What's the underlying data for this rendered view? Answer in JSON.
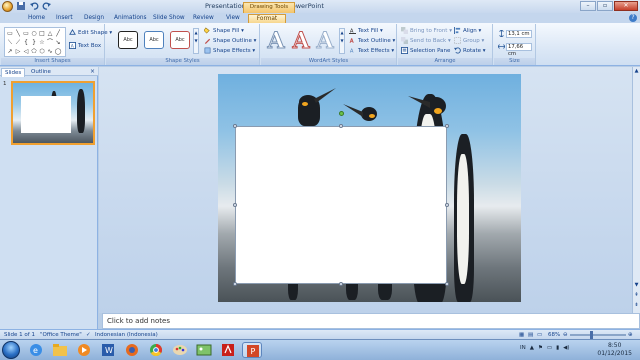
{
  "window": {
    "title": "Presentation1 - Microsoft PowerPoint",
    "contextual_tab": "Drawing Tools",
    "minimize": "–",
    "maximize": "▫",
    "close": "✕"
  },
  "tabs": {
    "home": "Home",
    "insert": "Insert",
    "design": "Design",
    "animations": "Animations",
    "slideshow": "Slide Show",
    "review": "Review",
    "view": "View",
    "format": "Format",
    "help": "?"
  },
  "ribbon": {
    "insert_shapes": {
      "label": "Insert Shapes",
      "edit_shape": "Edit Shape ▾",
      "text_box": "Text Box",
      "shape_glyphs": [
        "▭",
        "╲",
        "▭",
        "○",
        "□",
        "△",
        "╱",
        "⟍",
        "⟋",
        "{",
        "}",
        "☆",
        "⌒",
        "↘",
        "↗",
        "▷",
        "◁",
        "⬠",
        "⬡",
        "∿",
        "◯"
      ]
    },
    "shape_styles": {
      "label": "Shape Styles",
      "swatch_text": "Abc",
      "fill": "Shape Fill ▾",
      "outline": "Shape Outline ▾",
      "effects": "Shape Effects ▾"
    },
    "wordart": {
      "label": "WordArt Styles",
      "letter": "A",
      "text_fill": "Text Fill ▾",
      "text_outline": "Text Outline ▾",
      "text_effects": "Text Effects ▾"
    },
    "arrange": {
      "label": "Arrange",
      "bring_front": "Bring to Front ▾",
      "send_back": "Send to Back ▾",
      "selection_pane": "Selection Pane",
      "align": "Align ▾",
      "group": "Group ▾",
      "rotate": "Rotate ▾"
    },
    "size": {
      "label": "Size",
      "height": "13,1 cm",
      "width": "17,66 cm"
    }
  },
  "left_panel": {
    "tab_slides": "Slides",
    "tab_outline": "Outline",
    "close": "×",
    "slide_number": "1"
  },
  "notes": {
    "placeholder": "Click to add notes"
  },
  "statusbar": {
    "slide_info": "Slide 1 of 1",
    "theme": "\"Office Theme\"",
    "language": "Indonesian (Indonesia)",
    "zoom": "68%"
  },
  "taskbar": {
    "tray_lang": "IN",
    "time": "8:50",
    "date": "01/12/2015"
  },
  "colors": {
    "accent": "#f0a030",
    "ribbon": "#dce8f6",
    "taskbar": "#9fbde2"
  }
}
